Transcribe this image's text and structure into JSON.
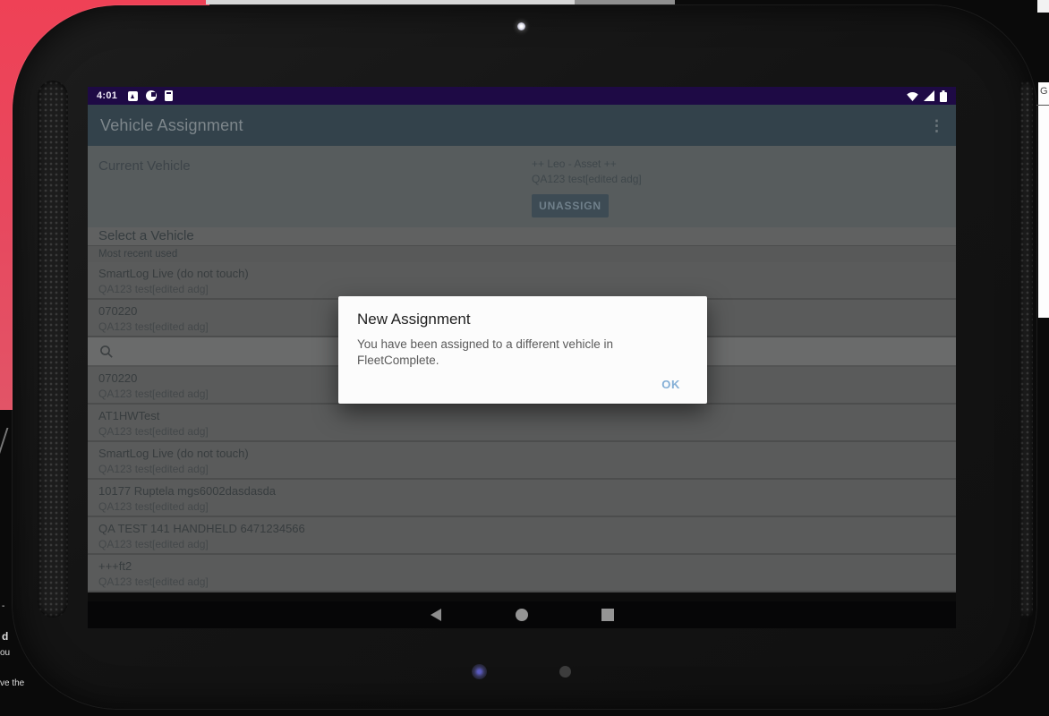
{
  "device": {
    "edge_letter": "G",
    "left_text_fragments": {
      "f0": "-",
      "f1": "d",
      "f2": "ou",
      "f3": "ve the"
    }
  },
  "status_bar": {
    "time": "4:01"
  },
  "toolbar": {
    "title": "Vehicle Assignment",
    "overflow_glyph": "⋮"
  },
  "current_vehicle": {
    "label": "Current Vehicle",
    "name": "++ Leo - Asset ++",
    "subtitle": "QA123 test[edited adg]",
    "unassign_label": "UNASSIGN"
  },
  "vehicle_list": {
    "section_header": "Select a Vehicle",
    "recent_header": "Most recent used",
    "recent": [
      {
        "title": "SmartLog Live (do not touch)",
        "subtitle": "QA123 test[edited adg]"
      },
      {
        "title": "070220",
        "subtitle": "QA123 test[edited adg]"
      }
    ],
    "items": [
      {
        "title": "070220",
        "subtitle": "QA123 test[edited adg]"
      },
      {
        "title": "AT1HWTest",
        "subtitle": "QA123 test[edited adg]"
      },
      {
        "title": "SmartLog Live (do not touch)",
        "subtitle": "QA123 test[edited adg]"
      },
      {
        "title": "10177 Ruptela mgs6002dasdasda",
        "subtitle": "QA123 test[edited adg]"
      },
      {
        "title": "QA TEST 141 HANDHELD 6471234566",
        "subtitle": "QA123 test[edited adg]"
      },
      {
        "title": "+++ft2",
        "subtitle": "QA123 test[edited adg]"
      }
    ]
  },
  "dialog": {
    "title": "New Assignment",
    "message": "You have been assigned to a different vehicle in FleetComplete.",
    "ok_label": "OK"
  },
  "colors": {
    "status_bar": "#1e0a45",
    "toolbar": "#33424b",
    "accent_ok": "#84afd6",
    "wallpaper_red": "#e84258",
    "row_bg_dimmed": "#5a5b5b"
  }
}
